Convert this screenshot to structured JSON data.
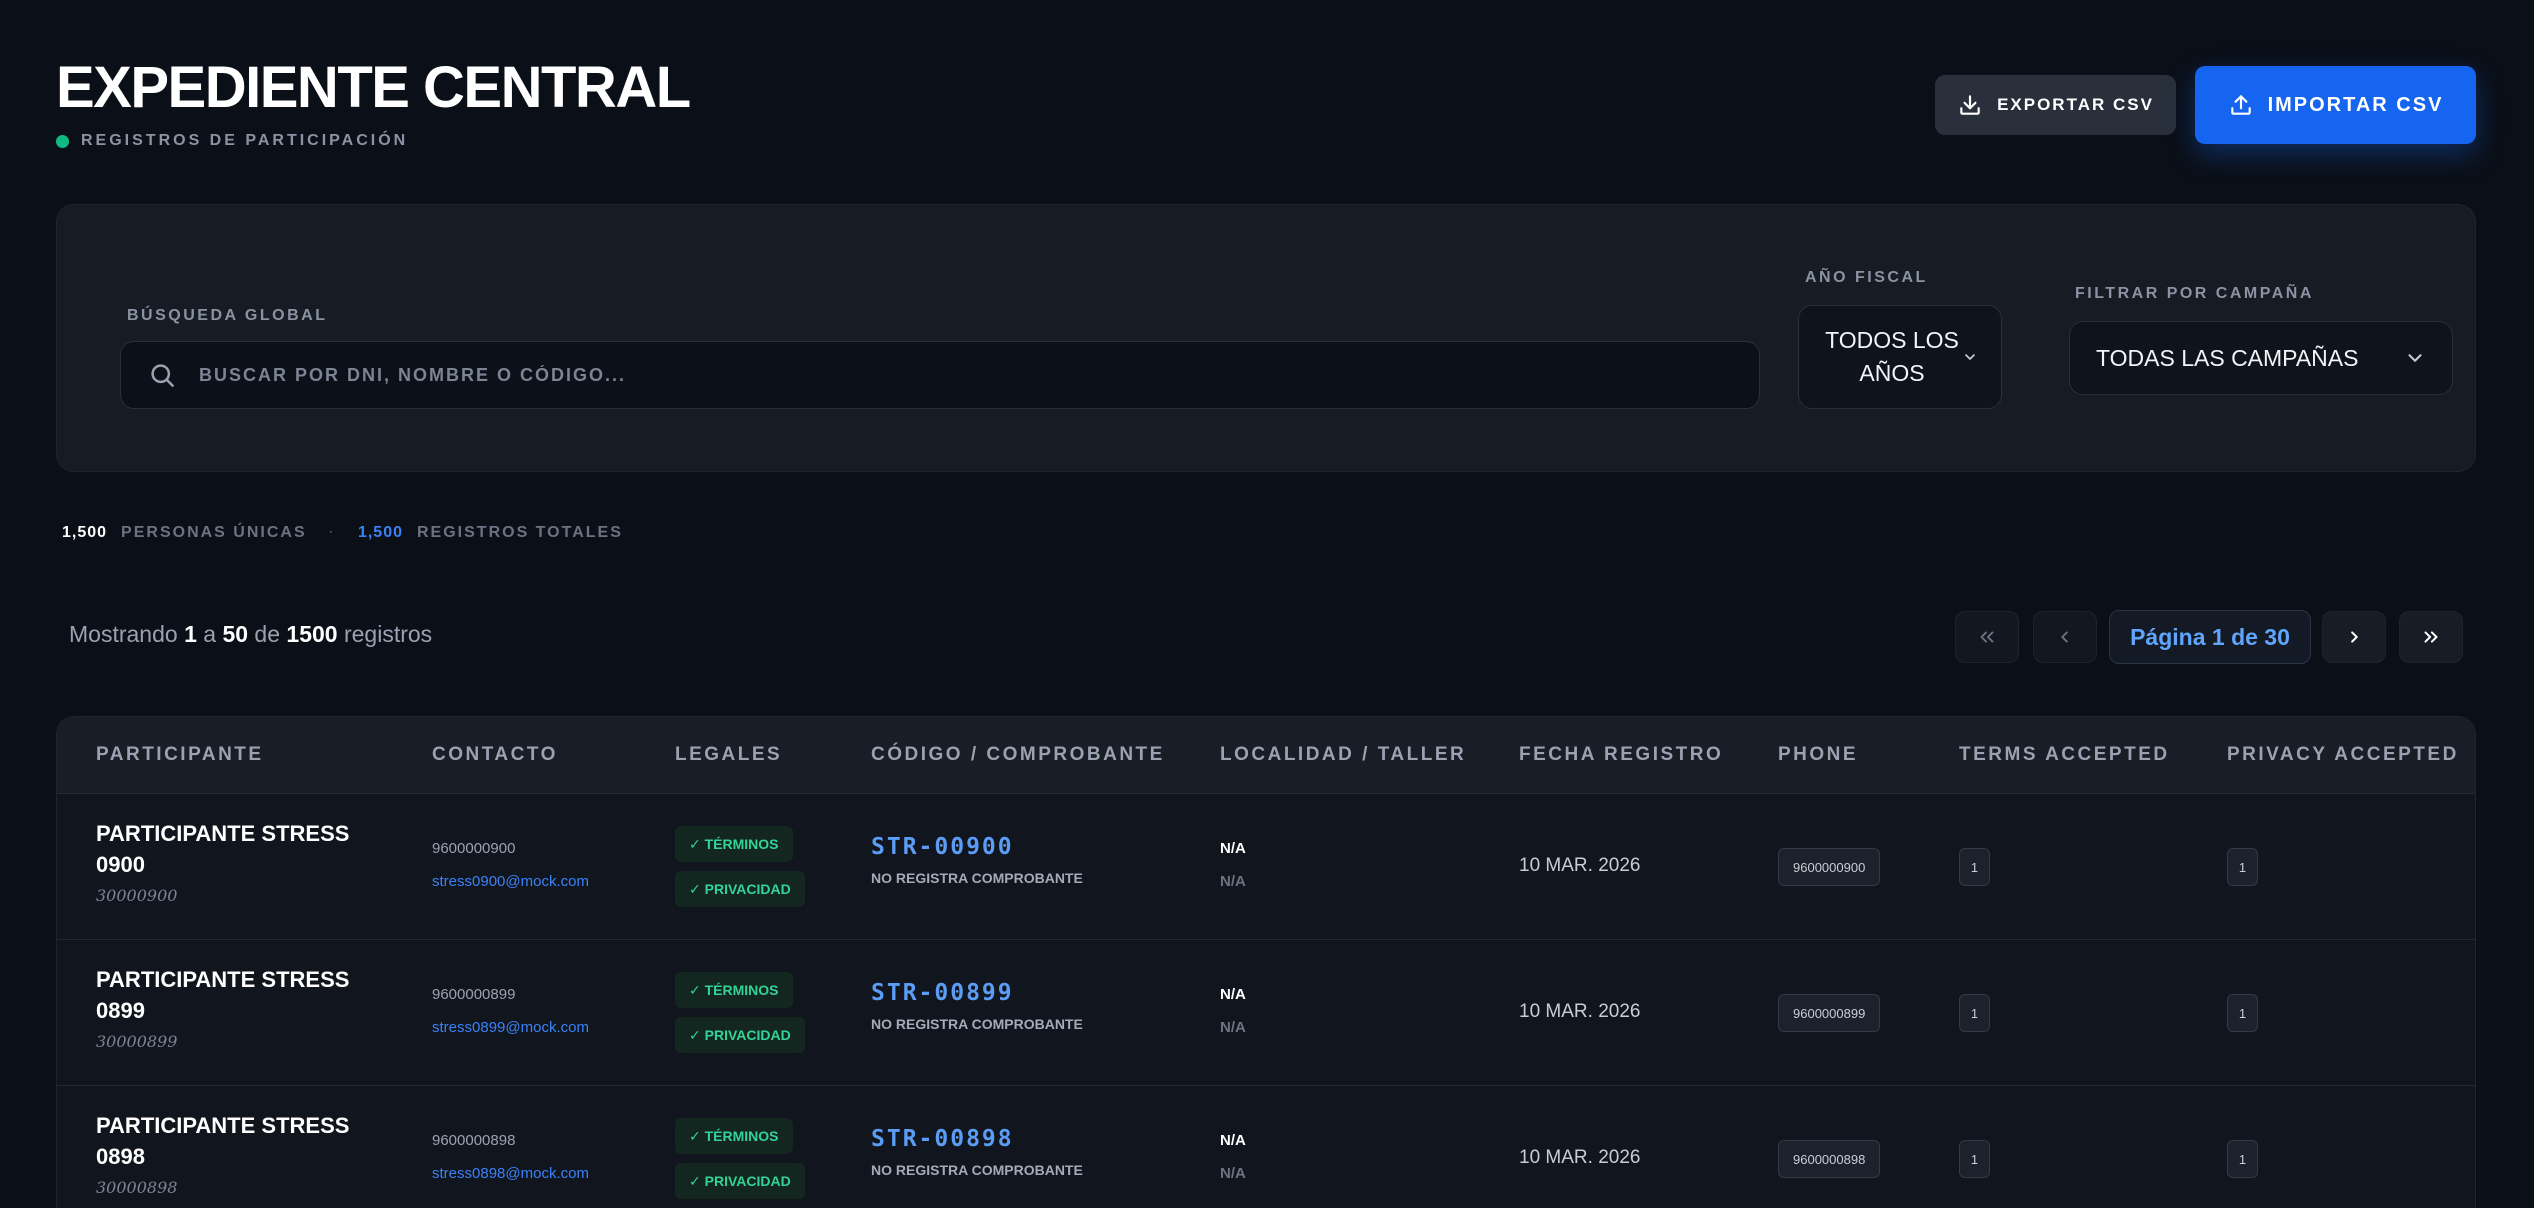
{
  "header": {
    "title": "EXPEDIENTE CENTRAL",
    "subtitle": "REGISTROS DE PARTICIPACIÓN",
    "export_label": "EXPORTAR CSV",
    "import_label": "IMPORTAR CSV"
  },
  "filters": {
    "search_label": "BÚSQUEDA GLOBAL",
    "search_placeholder": "BUSCAR POR DNI, NOMBRE O CÓDIGO...",
    "search_value": "",
    "year_label": "AÑO FISCAL",
    "year_value": "TODOS LOS AÑOS",
    "campaign_label": "FILTRAR POR CAMPAÑA",
    "campaign_value": "TODAS LAS CAMPAÑAS"
  },
  "stats": {
    "unique_count": "1,500",
    "unique_label": "PERSONAS ÚNICAS",
    "separator": "·",
    "total_count": "1,500",
    "total_label": "REGISTROS TOTALES"
  },
  "pagination": {
    "showing_prefix": "Mostrando",
    "from": "1",
    "to_word": "a",
    "to": "50",
    "of_word": "de",
    "total": "1500",
    "suffix": "registros",
    "page_label": "Página 1 de 30"
  },
  "table": {
    "columns": [
      "PARTICIPANTE",
      "CONTACTO",
      "LEGALES",
      "CÓDIGO / COMPROBANTE",
      "LOCALIDAD / TALLER",
      "FECHA REGISTRO",
      "PHONE",
      "TERMS ACCEPTED",
      "PRIVACY ACCEPTED"
    ],
    "rows": [
      {
        "name": "PARTICIPANTE STRESS 0900",
        "dni": "30000900",
        "phone": "9600000900",
        "email": "stress0900@mock.com",
        "tag_terms": "✓ TÉRMINOS",
        "tag_privacy": "✓ PRIVACIDAD",
        "code": "STR-00900",
        "receipt": "NO REGISTRA COMPROBANTE",
        "locality": "N/A",
        "workshop": "N/A",
        "date": "10 MAR. 2026",
        "phone_chip": "9600000900",
        "terms": "1",
        "privacy": "1"
      },
      {
        "name": "PARTICIPANTE STRESS 0899",
        "dni": "30000899",
        "phone": "9600000899",
        "email": "stress0899@mock.com",
        "tag_terms": "✓ TÉRMINOS",
        "tag_privacy": "✓ PRIVACIDAD",
        "code": "STR-00899",
        "receipt": "NO REGISTRA COMPROBANTE",
        "locality": "N/A",
        "workshop": "N/A",
        "date": "10 MAR. 2026",
        "phone_chip": "9600000899",
        "terms": "1",
        "privacy": "1"
      },
      {
        "name": "PARTICIPANTE STRESS 0898",
        "dni": "30000898",
        "phone": "9600000898",
        "email": "stress0898@mock.com",
        "tag_terms": "✓ TÉRMINOS",
        "tag_privacy": "✓ PRIVACIDAD",
        "code": "STR-00898",
        "receipt": "NO REGISTRA COMPROBANTE",
        "locality": "N/A",
        "workshop": "N/A",
        "date": "10 MAR. 2026",
        "phone_chip": "9600000898",
        "terms": "1",
        "privacy": "1"
      }
    ]
  },
  "icons": {
    "export": "download-icon",
    "import": "upload-icon",
    "search": "search-icon",
    "chevron": "chevron-down-icon",
    "first": "chevrons-left-icon",
    "prev": "chevron-left-icon",
    "next": "chevron-right-icon",
    "last": "chevrons-right-icon"
  },
  "colors": {
    "background": "#0b0f17",
    "accent_blue": "#1565f0",
    "status_green": "#10b981",
    "code_blue": "#5b9cf5"
  }
}
